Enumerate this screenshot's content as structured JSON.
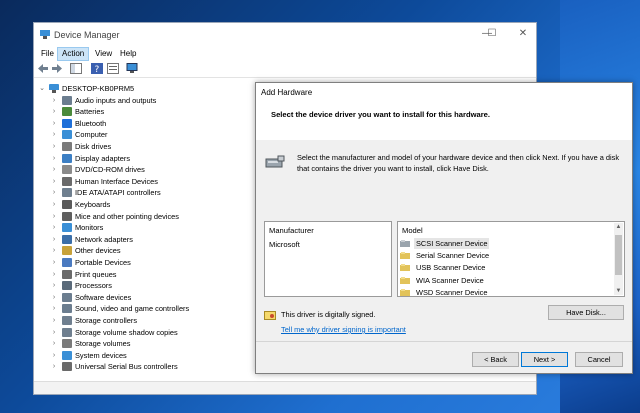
{
  "device_manager": {
    "title": "Device Manager",
    "window_controls": {
      "minimize": "—",
      "maximize": "☐",
      "close": "✕"
    },
    "menu": [
      "File",
      "Action",
      "View",
      "Help"
    ],
    "active_menu": "Action",
    "tree": {
      "root": "DESKTOP-KB0PRM5",
      "items": [
        {
          "label": "Audio inputs and outputs",
          "color": "#6b7d8f"
        },
        {
          "label": "Batteries",
          "color": "#4a8a3a"
        },
        {
          "label": "Bluetooth",
          "color": "#1e6fd9"
        },
        {
          "label": "Computer",
          "color": "#3a8fd6"
        },
        {
          "label": "Disk drives",
          "color": "#7a7a7a"
        },
        {
          "label": "Display adapters",
          "color": "#3c7fc4"
        },
        {
          "label": "DVD/CD-ROM drives",
          "color": "#8a8a8a"
        },
        {
          "label": "Human Interface Devices",
          "color": "#6a6a6a"
        },
        {
          "label": "IDE ATA/ATAPI controllers",
          "color": "#6f7f8f"
        },
        {
          "label": "Keyboards",
          "color": "#5a5a5a"
        },
        {
          "label": "Mice and other pointing devices",
          "color": "#5f5f5f"
        },
        {
          "label": "Monitors",
          "color": "#3a8fd6"
        },
        {
          "label": "Network adapters",
          "color": "#3b6ea8"
        },
        {
          "label": "Other devices",
          "color": "#c8a23a"
        },
        {
          "label": "Portable Devices",
          "color": "#4a7ac0"
        },
        {
          "label": "Print queues",
          "color": "#6a6a6a"
        },
        {
          "label": "Processors",
          "color": "#5a6a7a"
        },
        {
          "label": "Software devices",
          "color": "#6b7d8f"
        },
        {
          "label": "Sound, video and game controllers",
          "color": "#6b7d8f"
        },
        {
          "label": "Storage controllers",
          "color": "#6f7f8f"
        },
        {
          "label": "Storage volume shadow copies",
          "color": "#6f7f8f"
        },
        {
          "label": "Storage volumes",
          "color": "#7a7a7a"
        },
        {
          "label": "System devices",
          "color": "#3a8fd6"
        },
        {
          "label": "Universal Serial Bus controllers",
          "color": "#6a6a6a"
        }
      ]
    }
  },
  "add_hardware": {
    "title": "Add Hardware",
    "heading": "Select the device driver you want to install for this hardware.",
    "instructions": "Select the manufacturer and model of your hardware device and then click Next. If you have a disk that contains the driver you want to install, click Have Disk.",
    "manufacturer_header": "Manufacturer",
    "manufacturers": [
      "Microsoft"
    ],
    "model_header": "Model",
    "models": [
      {
        "label": "SCSI Scanner Device",
        "selected": true
      },
      {
        "label": "Serial Scanner Device",
        "selected": false
      },
      {
        "label": "USB Scanner Device",
        "selected": false
      },
      {
        "label": "WIA Scanner Device",
        "selected": false
      },
      {
        "label": "WSD Scanner Device",
        "selected": false
      }
    ],
    "signed_text": "This driver is digitally signed.",
    "signing_link": "Tell me why driver signing is important",
    "have_disk_label": "Have Disk...",
    "back_label": "< Back",
    "next_label": "Next >",
    "cancel_label": "Cancel"
  }
}
